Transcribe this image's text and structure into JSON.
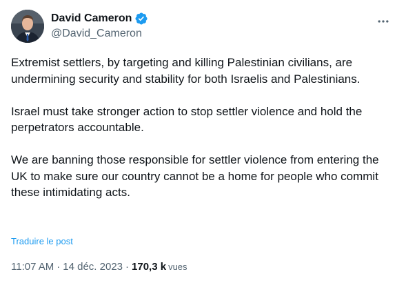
{
  "author": {
    "display_name": "David Cameron",
    "handle": "@David_Cameron",
    "verified": true
  },
  "icons": {
    "verified": "verified-badge-icon",
    "more": "more-options-icon"
  },
  "colors": {
    "verified_badge": "#1d9bf0",
    "link": "#1d9bf0",
    "secondary_text": "#536471",
    "primary_text": "#0f1419"
  },
  "tweet": {
    "paragraphs": [
      "Extremist settlers, by targeting and killing Palestinian civilians, are undermining security and stability for both Israelis and Palestinians.",
      "Israel must take stronger action to stop settler violence and hold the perpetrators accountable.",
      "We are banning those responsible for settler violence from entering the UK to make sure our country cannot be a home for people who commit these intimidating acts."
    ],
    "translate_label": "Traduire le post",
    "time": "11:07 AM",
    "separator": "·",
    "date": "14 déc. 2023",
    "views_count": "170,3 k",
    "views_label": "vues"
  }
}
